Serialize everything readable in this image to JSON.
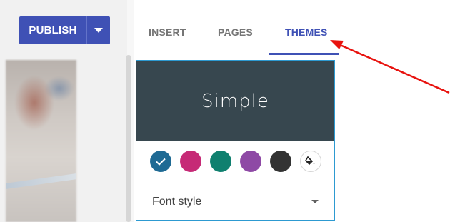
{
  "toolbar": {
    "publish_label": "PUBLISH",
    "publish_dropdown_icon": "caret-down-icon",
    "brand_color": "#3f51b5"
  },
  "tabs": [
    {
      "label": "INSERT",
      "active": false
    },
    {
      "label": "PAGES",
      "active": false
    },
    {
      "label": "THEMES",
      "active": true
    }
  ],
  "theme_card": {
    "name": "Simple",
    "header_color": "#37474f",
    "selection_border_color": "#2d9ad1",
    "swatches": [
      {
        "color": "#1f6a94",
        "selected": true,
        "icon": "check-icon"
      },
      {
        "color": "#c62a76",
        "selected": false
      },
      {
        "color": "#10806f",
        "selected": false
      },
      {
        "color": "#8e49a5",
        "selected": false
      },
      {
        "color": "#333333",
        "selected": false
      }
    ],
    "custom_color_icon": "paint-bucket-icon",
    "font_style_label": "Font style",
    "font_style_icon": "caret-down-icon"
  },
  "annotation": {
    "color": "#e8130f",
    "icon": "red-arrow-pointer"
  }
}
